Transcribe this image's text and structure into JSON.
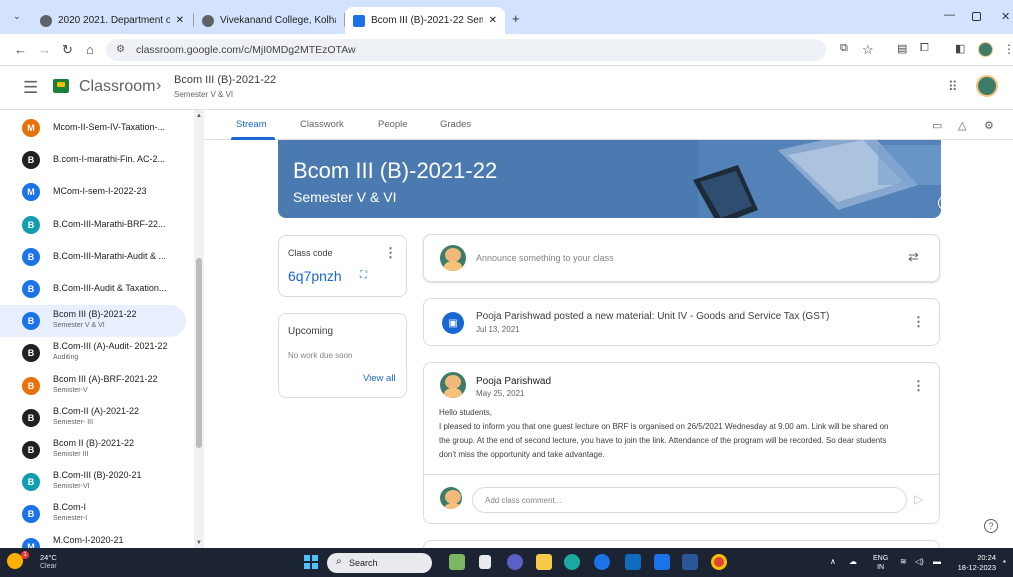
{
  "browser": {
    "tabs": [
      {
        "title": "2020 2021. Department of Con",
        "close": "✕"
      },
      {
        "title": "Vivekanand College, Kolhapur",
        "close": "✕"
      },
      {
        "title": "Bcom III (B)-2021-22 Semester",
        "close": "✕"
      }
    ],
    "new_tab": "+",
    "url": "classroom.google.com/c/MjI0MDg2MTEzOTAw"
  },
  "header": {
    "app_name": "Classroom",
    "crumb_sep": "›",
    "class_title": "Bcom III (B)-2021-22",
    "class_sub": "Semester V & VI"
  },
  "sidebar": {
    "items": [
      {
        "initial": "M",
        "name": "Mcom-II-Sem-IV-Taxation-...",
        "sub": "",
        "color": "#e8710a"
      },
      {
        "initial": "B",
        "name": "B.com-I-marathi-Fin. AC-2...",
        "sub": "",
        "color": "#202124"
      },
      {
        "initial": "M",
        "name": "MCom-I-sem-I-2022-23",
        "sub": "",
        "color": "#1a73e8"
      },
      {
        "initial": "B",
        "name": "B.Com-III-Marathi-BRF-22...",
        "sub": "",
        "color": "#129eaf"
      },
      {
        "initial": "B",
        "name": "B.Com-III-Marathi-Audit & ...",
        "sub": "",
        "color": "#1a73e8"
      },
      {
        "initial": "B",
        "name": "B.Com-III-Audit & Taxation...",
        "sub": "",
        "color": "#1a73e8"
      },
      {
        "initial": "B",
        "name": "Bcom III (B)-2021-22",
        "sub": "Semester V & VI",
        "color": "#1a73e8"
      },
      {
        "initial": "B",
        "name": "B.Com-III (A)-Audit- 2021-22",
        "sub": "Auditing",
        "color": "#202124"
      },
      {
        "initial": "B",
        "name": "Bcom III (A)-BRF-2021-22",
        "sub": "Semister-V",
        "color": "#e8710a"
      },
      {
        "initial": "B",
        "name": "B.Com-II (A)-2021-22",
        "sub": "Semester- III",
        "color": "#202124"
      },
      {
        "initial": "B",
        "name": "Bcom II (B)-2021-22",
        "sub": "Semister III",
        "color": "#202124"
      },
      {
        "initial": "B",
        "name": "B.Com-III (B)-2020-21",
        "sub": "Semister-VI",
        "color": "#129eaf"
      },
      {
        "initial": "B",
        "name": "B.Com-I",
        "sub": "Semester-I",
        "color": "#1a73e8"
      },
      {
        "initial": "M",
        "name": "M.Com-I-2020-21",
        "sub": "Semester-I",
        "color": "#1a73e8"
      }
    ],
    "selected_index": 6
  },
  "class_tabs": [
    "Stream",
    "Classwork",
    "People",
    "Grades"
  ],
  "banner": {
    "title": "Bcom III (B)-2021-22",
    "subtitle": "Semester V & VI",
    "color": "#4a7ab0"
  },
  "class_code": {
    "label": "Class code",
    "code": "6q7pnzh"
  },
  "upcoming": {
    "title": "Upcoming",
    "empty": "No work due soon",
    "view_all": "View all"
  },
  "announce": {
    "placeholder": "Announce something to your class"
  },
  "material_post": {
    "title": "Pooja Parishwad posted a new material: Unit IV - Goods and Service Tax (GST)",
    "date": "Jul 13, 2021"
  },
  "post": {
    "author": "Pooja Parishwad",
    "date": "May 25, 2021",
    "body_lines": [
      "Hello students,",
      "I pleased to inform you that one guest lecture on BRF is organised on 26/5/2021 Wednesday at 9.00 am. Link will be shared on",
      "the group. At the end of second lecture, you have to join the link. Attendance of the program will be recorded. So dear students",
      "don't miss the opportunity and take advantage."
    ],
    "comment_placeholder": "Add class comment..."
  },
  "taskbar": {
    "temperature": "24°C",
    "condition": "Clear",
    "weather_badge": "1",
    "search": "Search",
    "lang_top": "ENG",
    "lang_bottom": "IN",
    "time": "20:24",
    "date": "18-12-2023"
  }
}
